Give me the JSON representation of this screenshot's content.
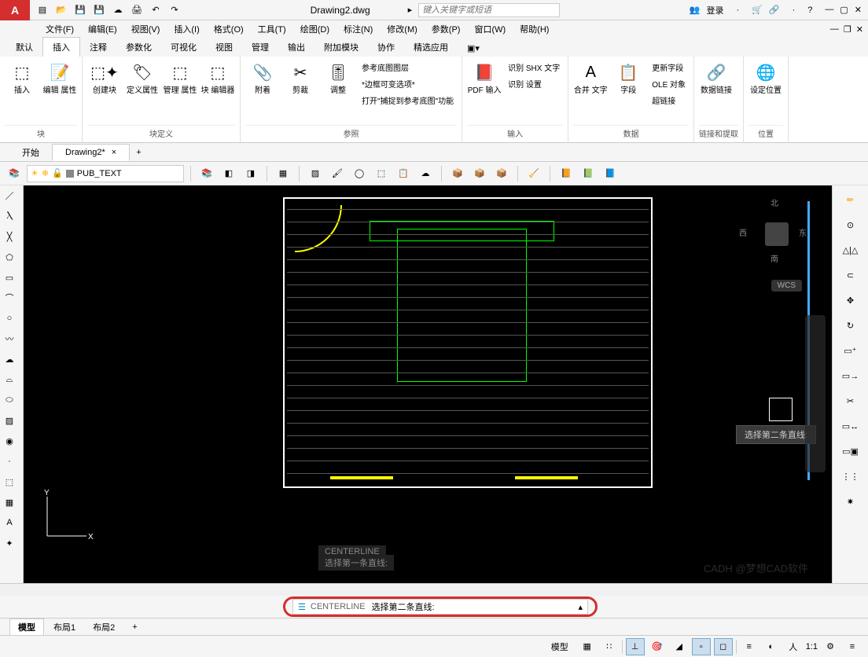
{
  "title": "Drawing2.dwg",
  "search_placeholder": "键入关键字或短语",
  "login_label": "登录",
  "menus": [
    "文件(F)",
    "编辑(E)",
    "视图(V)",
    "插入(I)",
    "格式(O)",
    "工具(T)",
    "绘图(D)",
    "标注(N)",
    "修改(M)",
    "参数(P)",
    "窗口(W)",
    "帮助(H)"
  ],
  "ribbon_tabs": [
    "默认",
    "插入",
    "注释",
    "参数化",
    "可视化",
    "视图",
    "管理",
    "输出",
    "附加模块",
    "协作",
    "精选应用"
  ],
  "active_ribbon_tab": 1,
  "ribbon_groups": {
    "block": {
      "insert": "插入",
      "edit_attr": "编辑\n属性",
      "label": "块"
    },
    "blockdef": {
      "create": "创建块",
      "defattr": "定义属性",
      "mgr_attr": "管理\n属性",
      "block_ed": "块\n编辑器",
      "label": "块定义"
    },
    "ref": {
      "attach": "附着",
      "clip": "剪裁",
      "adjust": "调整",
      "opts": [
        "参考底图图层",
        "*边框可变选项*",
        "打开\"捕捉到参考底图\"功能"
      ],
      "label": "参照"
    },
    "input": {
      "pdf": "PDF\n输入",
      "shx": "识别 SHX 文字",
      "opts": "识别 设置",
      "label": "输入"
    },
    "text": {
      "merge": "合并\n文字",
      "font": "字段",
      "label": ""
    },
    "data": {
      "opts": [
        "更新字段",
        "OLE 对象",
        "超链接"
      ],
      "link": "数据链接",
      "label": "数据"
    },
    "linkext": {
      "label": "链接和提取"
    },
    "position": {
      "setpos": "设定位置",
      "label": "位置"
    }
  },
  "doc_tabs": {
    "start": "开始",
    "drawing": "Drawing2*"
  },
  "layer_combo": "PUB_TEXT",
  "compass": {
    "n": "北",
    "s": "南",
    "e": "东",
    "w": "西"
  },
  "wcs": "WCS",
  "tooltip": "选择第二条直线:",
  "cmd_history1": "CENTERLINE",
  "cmd_history2": "选择第一条直线:",
  "cmdline_prefix": "CENTERLINE",
  "cmdline_prompt": "选择第二条直线:",
  "layout_tabs": [
    "模型",
    "布局1",
    "布局2"
  ],
  "status_model": "模型",
  "status_scale": "1:1",
  "watermark": "CADH @梦想CAD软件",
  "ucs": {
    "x": "X",
    "y": "Y"
  }
}
